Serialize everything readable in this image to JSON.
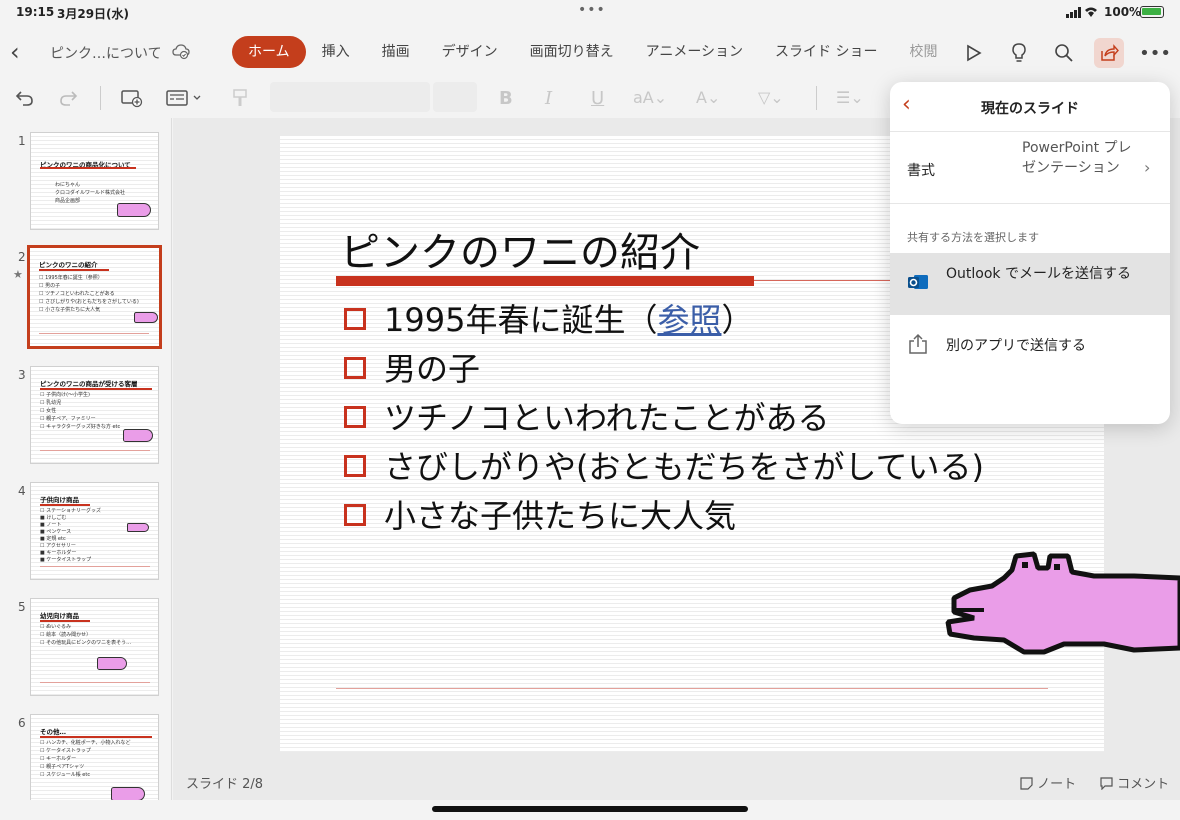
{
  "status": {
    "time": "19:15",
    "date": "3月29日(水)",
    "battery": "100%"
  },
  "topbar": {
    "doc_title": "ピンク…について",
    "tabs": [
      "ホーム",
      "挿入",
      "描画",
      "デザイン",
      "画面切り替え",
      "アニメーション",
      "スライド ショー",
      "校閲"
    ]
  },
  "thumbnails": [
    {
      "num": "1",
      "title": "ピンクのワニの商品化について",
      "lines": [
        "わにちゃん",
        "クロコダイルワールド株式会社",
        "商品企画部"
      ]
    },
    {
      "num": "2",
      "title": "ピンクのワニの紹介",
      "lines": [
        "☐ 1995年春に誕生（参照）",
        "☐ 男の子",
        "☐ ツチノコといわれたことがある",
        "☐ さびしがりや(おともだちをさがしている)",
        "☐ 小さな子供たちに大人気"
      ]
    },
    {
      "num": "3",
      "title": "ピンクのワニの商品が受ける客層",
      "lines": [
        "☐ 子供向け(～小学生)",
        "☐ 乳幼児",
        "☐ 女性",
        "☐ 親子ペア、ファミリー",
        "☐ キャラクターグッズ好きな方 etc"
      ]
    },
    {
      "num": "4",
      "title": "子供向け商品",
      "lines": [
        "☐ ステーショナリーグッズ",
        "  ■ けしごむ",
        "  ■ ノート",
        "  ■ ペンケース",
        "  ■ 定規 etc",
        "☐ アクセサリー",
        "  ■ キーホルダー",
        "  ■ ケータイストラップ"
      ]
    },
    {
      "num": "5",
      "title": "幼児向け商品",
      "lines": [
        "☐ ぬいぐるみ",
        "☐ 絵本（読み聞かせ）",
        "☐ その他玩具にピンクのワニを表そう…"
      ]
    },
    {
      "num": "6",
      "title": "その他…",
      "lines": [
        "☐ ハンカチ、化粧ポーチ、小物入れなど",
        "☐ ケータイストラップ",
        "☐ キーホルダー",
        "☐ 親子ペアTシャツ",
        "☐ スケジュール帳 etc"
      ]
    }
  ],
  "slide": {
    "title": "ピンクのワニの紹介",
    "bullet1_pre": "1995年春に誕生（",
    "bullet1_link": "参照",
    "bullet1_post": "）",
    "bullets": [
      "男の子",
      "ツチノコといわれたことがある",
      "さびしがりや(おともだちをさがしている)",
      "小さな子供たちに大人気"
    ]
  },
  "footer": {
    "slide_count": "スライド 2/8",
    "notes": "ノート",
    "comments": "コメント"
  },
  "popover": {
    "title": "現在のスライド",
    "format_label": "書式",
    "format_value": "PowerPoint プレゼンテーション",
    "section": "共有する方法を選択します",
    "outlook": "Outlook でメールを送信する",
    "other_app": "別のアプリで送信する"
  },
  "colors": {
    "accent": "#c43e1c",
    "slide_red": "#c8321e",
    "croc_pink": "#ea9de8",
    "link": "#3b5ea8"
  }
}
